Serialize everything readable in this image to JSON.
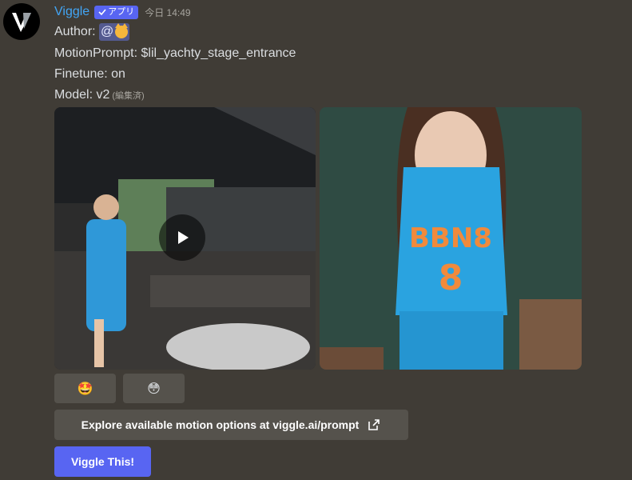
{
  "message": {
    "username": "Viggle",
    "app_badge": "アプリ",
    "timestamp": "今日 14:49",
    "author_label": "Author: ",
    "author_mention": "@",
    "motion_prompt": "MotionPrompt: $lil_yachty_stage_entrance",
    "finetune": "Finetune: on",
    "model": "Model: v2",
    "edited": "(編集済)"
  },
  "reactions": [
    {
      "emoji": "🤩"
    },
    {
      "emoji": "😳"
    }
  ],
  "buttons": {
    "explore_label": "Explore available motion options at viggle.ai/prompt",
    "viggle_label": "Viggle This!"
  },
  "colors": {
    "background": "#403c36",
    "username": "#42a5f5",
    "accent": "#5865f2",
    "button_gray": "#55524c"
  },
  "icons": {
    "avatar": "viggle-logo-icon",
    "badge": "checkmark-icon",
    "play": "play-icon",
    "external": "external-link-icon",
    "mention_avatar": "cat-emoji-icon"
  }
}
